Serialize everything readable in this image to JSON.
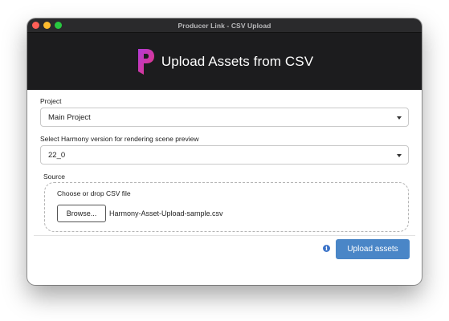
{
  "window": {
    "title": "Producer Link - CSV Upload"
  },
  "banner": {
    "title": "Upload Assets from CSV",
    "logo_icon": "producer-link-logo"
  },
  "project": {
    "label": "Project",
    "value": "Main Project"
  },
  "harmony": {
    "label": "Select Harmony version for rendering scene preview",
    "value": "22_0"
  },
  "source": {
    "label": "Source",
    "hint": "Choose or drop CSV file",
    "browse_label": "Browse...",
    "file_name": "Harmony-Asset-Upload-sample.csv"
  },
  "footer": {
    "info_icon": "info-icon",
    "upload_label": "Upload assets"
  },
  "colors": {
    "accent": "#4a86c7",
    "banner_bg": "#1c1c1e",
    "titlebar_bg": "#2a2a2c"
  }
}
